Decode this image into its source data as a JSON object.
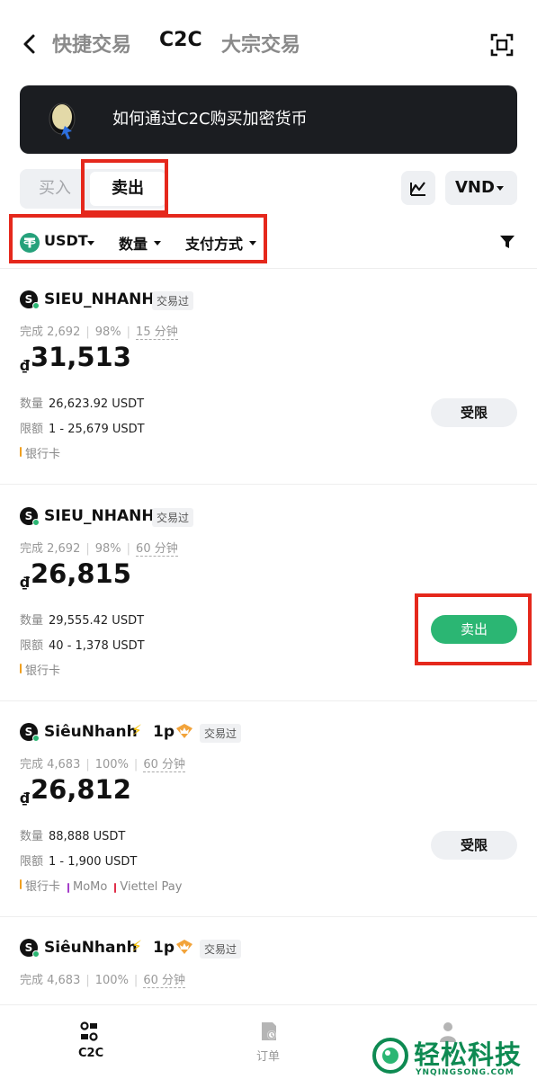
{
  "header": {
    "tabs": [
      {
        "label": "快捷交易"
      },
      {
        "label": "C2C",
        "active": true
      },
      {
        "label": "大宗交易"
      }
    ]
  },
  "banner": {
    "text": "如何通过C2C购买加密货币"
  },
  "side_toggle": {
    "buy_label": "买入",
    "sell_label": "卖出",
    "selected": "卖出"
  },
  "currency": {
    "label": "VND"
  },
  "filters": {
    "coin": "USDT",
    "amount": "数量",
    "payment": "支付方式"
  },
  "ads": [
    {
      "name": "SIEU_NHANH",
      "level": "",
      "badge": "交易过",
      "stats": {
        "completed": "完成 2,692",
        "rate": "98%",
        "time": "15 分钟"
      },
      "currency_symbol": "₫",
      "price": "31,513",
      "quantity_label": "数量",
      "quantity": "26,623.92 USDT",
      "limit_label": "限额",
      "limit": "1 - 25,679 USDT",
      "payments": [
        {
          "name": "银行卡",
          "color": "#f0a020"
        }
      ],
      "action": "受限",
      "action_type": "limited"
    },
    {
      "name": "SIEU_NHANH",
      "level": "",
      "badge": "交易过",
      "stats": {
        "completed": "完成 2,692",
        "rate": "98%",
        "time": "60 分钟"
      },
      "currency_symbol": "₫",
      "price": "26,815",
      "quantity_label": "数量",
      "quantity": "29,555.42 USDT",
      "limit_label": "限额",
      "limit": "40 - 1,378 USDT",
      "payments": [
        {
          "name": "银行卡",
          "color": "#f0a020"
        }
      ],
      "action": "卖出",
      "action_type": "sell"
    },
    {
      "name": "SiêuNhanh",
      "level": "1p",
      "badge": "交易过",
      "stats": {
        "completed": "完成 4,683",
        "rate": "100%",
        "time": "60 分钟"
      },
      "currency_symbol": "₫",
      "price": "26,812",
      "quantity_label": "数量",
      "quantity": "88,888 USDT",
      "limit_label": "限额",
      "limit": "1 - 1,900 USDT",
      "payments": [
        {
          "name": "银行卡",
          "color": "#f0a020"
        },
        {
          "name": "MoMo",
          "color": "#a43ec9"
        },
        {
          "name": "Viettel Pay",
          "color": "#e0304a"
        }
      ],
      "action": "受限",
      "action_type": "limited"
    },
    {
      "name": "SiêuNhanh",
      "level": "1p",
      "badge": "交易过",
      "stats": {
        "completed": "完成 4,683",
        "rate": "100%",
        "time": "60 分钟"
      }
    }
  ],
  "bottom_nav": {
    "c2c_label": "C2C",
    "orders_label": "订单"
  },
  "watermark": {
    "text": "轻松科技",
    "sub": "YNQINGSONG.COM"
  },
  "colors": {
    "accent_green": "#2bb673",
    "highlight_red": "#e5281c",
    "banner_bg": "#1b1d21"
  }
}
